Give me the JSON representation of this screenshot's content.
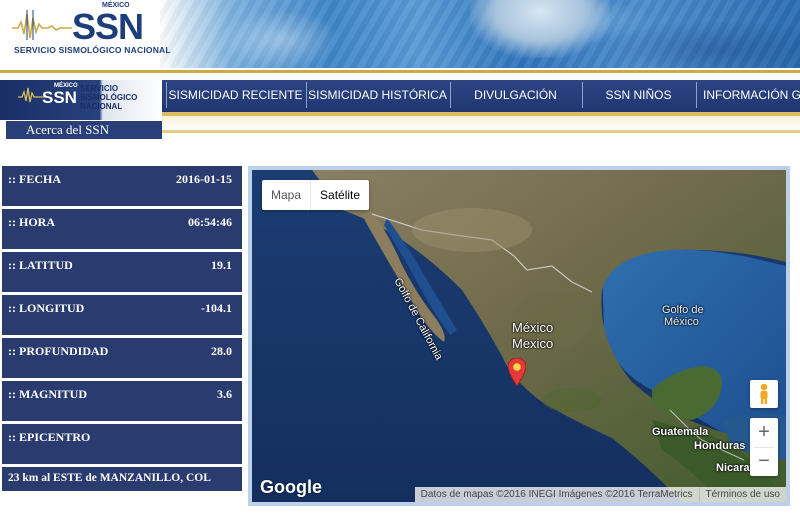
{
  "header": {
    "logo_small_text": "MÉXICO",
    "logo_text": "SSN",
    "logo_subtitle": "SERVICIO SISMOLÓGICO NACIONAL"
  },
  "nav_logo": {
    "mx": "MÉXICO",
    "ssn": "SSN",
    "line1": "SERVICIO",
    "line2": "SISMOLÓGICO",
    "line3": "NACIONAL"
  },
  "sidebar_link": "Acerca del SSN",
  "nav": [
    {
      "label": "SISMICIDAD RECIENTE"
    },
    {
      "label": "SISMICIDAD HISTÓRICA"
    },
    {
      "label": "DIVULGACIÓN"
    },
    {
      "label": "SSN NIÑOS"
    },
    {
      "label": "INFORMACIÓN GEN"
    }
  ],
  "quake": {
    "fecha": {
      "label": ":: FECHA",
      "value": "2016-01-15"
    },
    "hora": {
      "label": ":: HORA",
      "value": "06:54:46"
    },
    "latitud": {
      "label": ":: LATITUD",
      "value": "19.1"
    },
    "longitud": {
      "label": ":: LONGITUD",
      "value": "-104.1"
    },
    "profundidad": {
      "label": ":: PROFUNDIDAD",
      "value": "28.0"
    },
    "magnitud": {
      "label": ":: MAGNITUD",
      "value": "3.6"
    },
    "epicentro": {
      "label": ":: EPICENTRO"
    },
    "epicentro_text": "23 km al ESTE de MANZANILLO, COL"
  },
  "map": {
    "type_map": "Mapa",
    "type_satellite": "Satélite",
    "zoom_in": "+",
    "zoom_out": "−",
    "logo": "Google",
    "attribution": "Datos de mapas ©2016 INEGI Imágenes ©2016 TerraMetrics",
    "terms": "Términos de uso",
    "labels": {
      "gulf_california": "Golfo de California",
      "mexico1": "México",
      "mexico2": "Mexico",
      "gulf_mexico1": "Golfo de",
      "gulf_mexico2": "México",
      "guatemala": "Guatemala",
      "honduras": "Honduras",
      "nicaragua": "Nicara"
    },
    "pin_color": "#e53935"
  }
}
